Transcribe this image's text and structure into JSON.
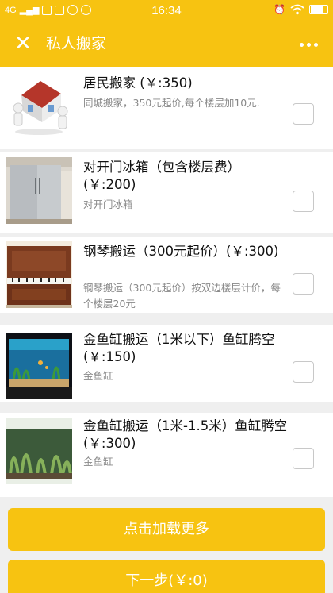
{
  "status_bar": {
    "network": "4G",
    "time": "16:34"
  },
  "header": {
    "title": "私人搬家",
    "close_icon": "close-icon",
    "more_icon": "more-icon"
  },
  "items": [
    {
      "title": "居民搬家 (￥:350)",
      "desc": "同城搬家，350元起价,每个楼层加10元.",
      "checked": false
    },
    {
      "title": "对开门冰箱（包含楼层费）(￥:200)",
      "desc": "对开门冰箱",
      "checked": false
    },
    {
      "title": "钢琴搬运（300元起价）(￥:300)",
      "desc": "钢琴搬运（300元起价）按双边楼层计价，每个楼层20元",
      "checked": false
    },
    {
      "title": "金鱼缸搬运（1米以下）鱼缸腾空 (￥:150)",
      "desc": "金鱼缸",
      "checked": false
    },
    {
      "title": "金鱼缸搬运（1米-1.5米）鱼缸腾空 (￥:300)",
      "desc": "金鱼缸",
      "checked": false
    }
  ],
  "buttons": {
    "load_more": "点击加载更多",
    "next": "下一步(￥:0)"
  },
  "colors": {
    "accent": "#f7c311"
  }
}
